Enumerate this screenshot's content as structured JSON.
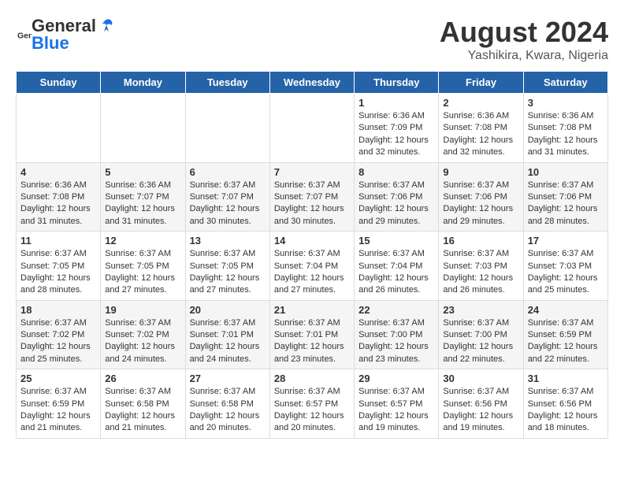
{
  "logo": {
    "general": "General",
    "blue": "Blue"
  },
  "header": {
    "month_year": "August 2024",
    "location": "Yashikira, Kwara, Nigeria"
  },
  "days_of_week": [
    "Sunday",
    "Monday",
    "Tuesday",
    "Wednesday",
    "Thursday",
    "Friday",
    "Saturday"
  ],
  "weeks": [
    [
      {
        "day": "",
        "content": ""
      },
      {
        "day": "",
        "content": ""
      },
      {
        "day": "",
        "content": ""
      },
      {
        "day": "",
        "content": ""
      },
      {
        "day": "1",
        "content": "Sunrise: 6:36 AM\nSunset: 7:09 PM\nDaylight: 12 hours\nand 32 minutes."
      },
      {
        "day": "2",
        "content": "Sunrise: 6:36 AM\nSunset: 7:08 PM\nDaylight: 12 hours\nand 32 minutes."
      },
      {
        "day": "3",
        "content": "Sunrise: 6:36 AM\nSunset: 7:08 PM\nDaylight: 12 hours\nand 31 minutes."
      }
    ],
    [
      {
        "day": "4",
        "content": "Sunrise: 6:36 AM\nSunset: 7:08 PM\nDaylight: 12 hours\nand 31 minutes."
      },
      {
        "day": "5",
        "content": "Sunrise: 6:36 AM\nSunset: 7:07 PM\nDaylight: 12 hours\nand 31 minutes."
      },
      {
        "day": "6",
        "content": "Sunrise: 6:37 AM\nSunset: 7:07 PM\nDaylight: 12 hours\nand 30 minutes."
      },
      {
        "day": "7",
        "content": "Sunrise: 6:37 AM\nSunset: 7:07 PM\nDaylight: 12 hours\nand 30 minutes."
      },
      {
        "day": "8",
        "content": "Sunrise: 6:37 AM\nSunset: 7:06 PM\nDaylight: 12 hours\nand 29 minutes."
      },
      {
        "day": "9",
        "content": "Sunrise: 6:37 AM\nSunset: 7:06 PM\nDaylight: 12 hours\nand 29 minutes."
      },
      {
        "day": "10",
        "content": "Sunrise: 6:37 AM\nSunset: 7:06 PM\nDaylight: 12 hours\nand 28 minutes."
      }
    ],
    [
      {
        "day": "11",
        "content": "Sunrise: 6:37 AM\nSunset: 7:05 PM\nDaylight: 12 hours\nand 28 minutes."
      },
      {
        "day": "12",
        "content": "Sunrise: 6:37 AM\nSunset: 7:05 PM\nDaylight: 12 hours\nand 27 minutes."
      },
      {
        "day": "13",
        "content": "Sunrise: 6:37 AM\nSunset: 7:05 PM\nDaylight: 12 hours\nand 27 minutes."
      },
      {
        "day": "14",
        "content": "Sunrise: 6:37 AM\nSunset: 7:04 PM\nDaylight: 12 hours\nand 27 minutes."
      },
      {
        "day": "15",
        "content": "Sunrise: 6:37 AM\nSunset: 7:04 PM\nDaylight: 12 hours\nand 26 minutes."
      },
      {
        "day": "16",
        "content": "Sunrise: 6:37 AM\nSunset: 7:03 PM\nDaylight: 12 hours\nand 26 minutes."
      },
      {
        "day": "17",
        "content": "Sunrise: 6:37 AM\nSunset: 7:03 PM\nDaylight: 12 hours\nand 25 minutes."
      }
    ],
    [
      {
        "day": "18",
        "content": "Sunrise: 6:37 AM\nSunset: 7:02 PM\nDaylight: 12 hours\nand 25 minutes."
      },
      {
        "day": "19",
        "content": "Sunrise: 6:37 AM\nSunset: 7:02 PM\nDaylight: 12 hours\nand 24 minutes."
      },
      {
        "day": "20",
        "content": "Sunrise: 6:37 AM\nSunset: 7:01 PM\nDaylight: 12 hours\nand 24 minutes."
      },
      {
        "day": "21",
        "content": "Sunrise: 6:37 AM\nSunset: 7:01 PM\nDaylight: 12 hours\nand 23 minutes."
      },
      {
        "day": "22",
        "content": "Sunrise: 6:37 AM\nSunset: 7:00 PM\nDaylight: 12 hours\nand 23 minutes."
      },
      {
        "day": "23",
        "content": "Sunrise: 6:37 AM\nSunset: 7:00 PM\nDaylight: 12 hours\nand 22 minutes."
      },
      {
        "day": "24",
        "content": "Sunrise: 6:37 AM\nSunset: 6:59 PM\nDaylight: 12 hours\nand 22 minutes."
      }
    ],
    [
      {
        "day": "25",
        "content": "Sunrise: 6:37 AM\nSunset: 6:59 PM\nDaylight: 12 hours\nand 21 minutes."
      },
      {
        "day": "26",
        "content": "Sunrise: 6:37 AM\nSunset: 6:58 PM\nDaylight: 12 hours\nand 21 minutes."
      },
      {
        "day": "27",
        "content": "Sunrise: 6:37 AM\nSunset: 6:58 PM\nDaylight: 12 hours\nand 20 minutes."
      },
      {
        "day": "28",
        "content": "Sunrise: 6:37 AM\nSunset: 6:57 PM\nDaylight: 12 hours\nand 20 minutes."
      },
      {
        "day": "29",
        "content": "Sunrise: 6:37 AM\nSunset: 6:57 PM\nDaylight: 12 hours\nand 19 minutes."
      },
      {
        "day": "30",
        "content": "Sunrise: 6:37 AM\nSunset: 6:56 PM\nDaylight: 12 hours\nand 19 minutes."
      },
      {
        "day": "31",
        "content": "Sunrise: 6:37 AM\nSunset: 6:56 PM\nDaylight: 12 hours\nand 18 minutes."
      }
    ]
  ]
}
